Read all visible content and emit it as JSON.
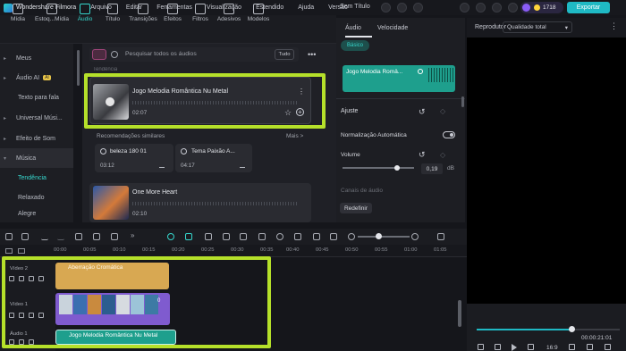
{
  "app": {
    "name": "Wondershare Filmora",
    "doc_title": "Sem Título",
    "credits": "1718",
    "export_label": "Exportar"
  },
  "menu": [
    "Arquivo",
    "Editar",
    "Ferramentas",
    "Visualização",
    "Estendido",
    "Ajuda",
    "Versão"
  ],
  "toolbar_tabs": [
    {
      "label": "Mídia",
      "icon": "media-icon"
    },
    {
      "label": "Estoq...Mídia",
      "icon": "stock-media-icon"
    },
    {
      "label": "Áudio",
      "icon": "music-note-icon"
    },
    {
      "label": "Título",
      "icon": "title-icon"
    },
    {
      "label": "Transições",
      "icon": "transitions-icon"
    },
    {
      "label": "Efeitos",
      "icon": "effects-icon"
    },
    {
      "label": "Filtros",
      "icon": "filters-icon"
    },
    {
      "label": "Adesivos",
      "icon": "stickers-icon"
    },
    {
      "label": "Modelos",
      "icon": "templates-icon"
    }
  ],
  "sidebar": [
    {
      "label": "Meus"
    },
    {
      "label": "Áudio AI",
      "tag": "AI"
    },
    {
      "label": "Texto para fala"
    },
    {
      "label": "Universal Músi..."
    },
    {
      "label": "Efeito de Som"
    },
    {
      "label": "Música"
    },
    {
      "label": "Tendência"
    },
    {
      "label": "Relaxado"
    },
    {
      "label": "Alegre"
    }
  ],
  "search": {
    "placeholder": "Pesquisar todos os áudios",
    "all_label": "Tudo",
    "more": "•••"
  },
  "section_partial": "Tendência",
  "featured": {
    "title": "Jogo Melodia Romântica Nu Metal",
    "duration": "02:07"
  },
  "similar": {
    "heading": "Recomendações similares",
    "more": "Mais >",
    "items": [
      {
        "title": "beleza 180 01",
        "duration": "03:12"
      },
      {
        "title": "Tema Paixão A...",
        "duration": "04:17"
      }
    ]
  },
  "track2": {
    "title": "One More Heart",
    "duration": "02:10"
  },
  "props": {
    "tabs": [
      "Áudio",
      "Velocidade"
    ],
    "basic": "Básico",
    "clip_title": "Jogo Melodia Româ...",
    "ajuste": "Ajuste",
    "normalizacao": "Normalização Automática",
    "volume_label": "Volume",
    "volume_value": "0,19",
    "db": "dB",
    "canais": "Canais de áudio",
    "reset": "Redefinir"
  },
  "player": {
    "title": "Reprodutor",
    "quality": "Qualidade total",
    "time": "00:00:21:01",
    "ratio": "16:9"
  },
  "ruler": [
    "00:00",
    "00:05",
    "00:10",
    "00:15",
    "00:20",
    "00:25",
    "00:30",
    "00:35",
    "00:40",
    "00:45",
    "00:50",
    "00:55",
    "01:00",
    "01:05"
  ],
  "tracks": [
    {
      "label": "Vídeo 2"
    },
    {
      "label": "Vídeo 1"
    },
    {
      "label": "Áudio 1"
    }
  ],
  "clips": {
    "fx": "Aberração Cromática",
    "audio": "Jogo Melodia Romântica Nu Metal",
    "video_tag": "0"
  }
}
